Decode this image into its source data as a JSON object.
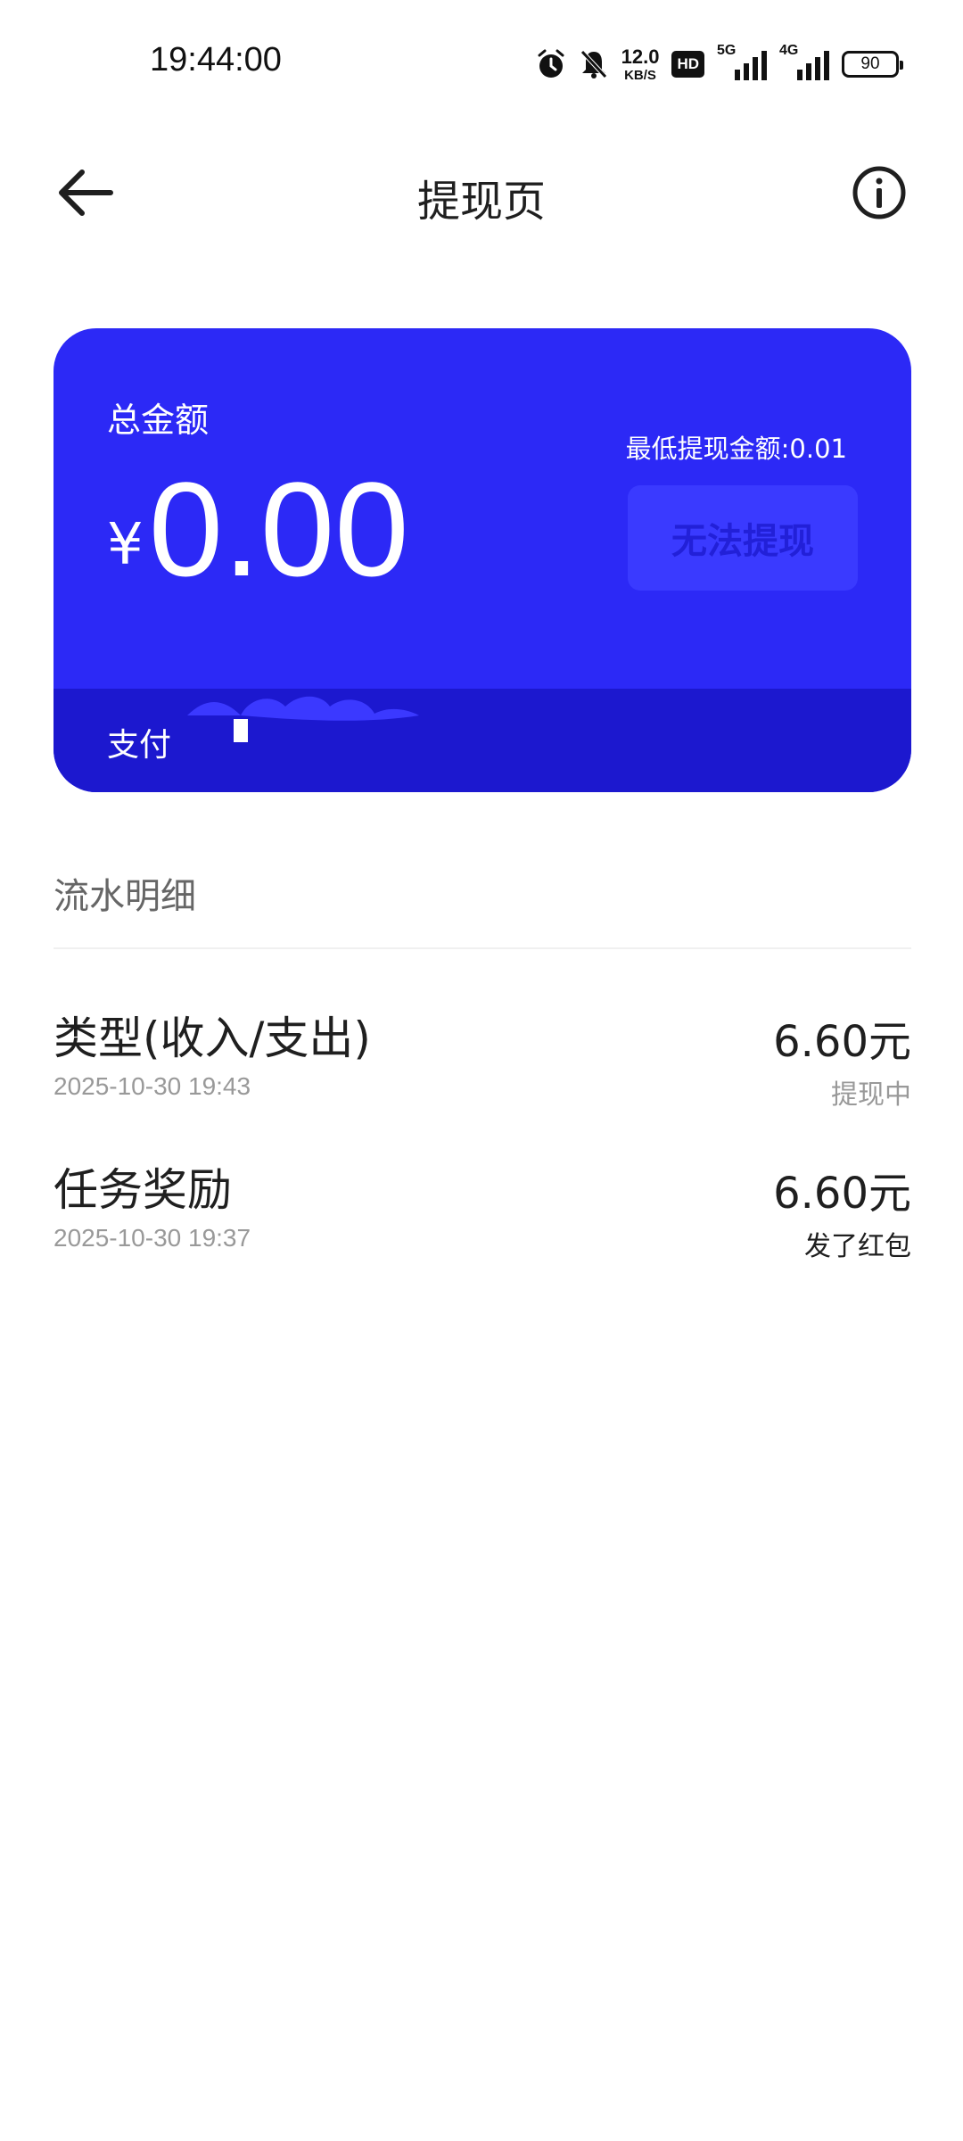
{
  "status_bar": {
    "time": "19:44:00",
    "net_speed_value": "12.0",
    "net_speed_unit": "KB/S",
    "hd_badge": "HD",
    "signal_1_label": "5G",
    "signal_2_label": "4G",
    "battery": "90",
    "icons": [
      "alarm-icon",
      "mute-bell-icon",
      "hd-icon",
      "signal-5g-icon",
      "signal-4g-icon",
      "battery-icon"
    ]
  },
  "header": {
    "title": "提现页",
    "back_icon": "arrow-left-icon",
    "info_icon": "info-circle-icon"
  },
  "balance_card": {
    "label": "总金额",
    "currency": "¥",
    "amount": "0.00",
    "min_withdraw": "最低提现金额:0.01",
    "withdraw_button": "无法提现",
    "pay_label": "支付",
    "colors": {
      "card": "#2c29f6",
      "footer": "#1c18cf",
      "button": "#3a3aff",
      "button_text": "#2220d8"
    }
  },
  "details": {
    "section_title": "流水明细",
    "rows": [
      {
        "title": "类型(收入/支出)",
        "time": "2025-10-30 19:43",
        "amount": "6.60元",
        "status": "提现中",
        "status_color": "#999999"
      },
      {
        "title": "任务奖励",
        "time": "2025-10-30 19:37",
        "amount": "6.60元",
        "status": "发了红包",
        "status_color": "#1f1f1f"
      }
    ]
  }
}
